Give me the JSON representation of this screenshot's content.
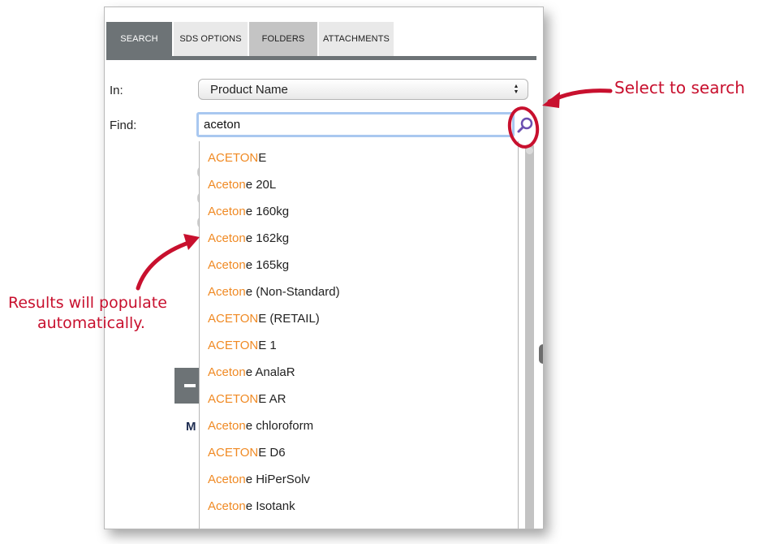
{
  "tabs": [
    {
      "label": "SEARCH",
      "state": "active"
    },
    {
      "label": "SDS OPTIONS",
      "state": "normal"
    },
    {
      "label": "FOLDERS",
      "state": "grey"
    },
    {
      "label": "ATTACHMENTS",
      "state": "normal"
    }
  ],
  "form": {
    "in_label": "In:",
    "in_value": "Product Name",
    "find_label": "Find:",
    "find_value": "aceton"
  },
  "results": [
    {
      "match": "ACETON",
      "rest": "E"
    },
    {
      "match": "Aceton",
      "rest": "e 20L"
    },
    {
      "match": "Aceton",
      "rest": "e 160kg"
    },
    {
      "match": "Aceton",
      "rest": "e 162kg"
    },
    {
      "match": "Aceton",
      "rest": "e 165kg"
    },
    {
      "match": "Aceton",
      "rest": "e (Non-Standard)"
    },
    {
      "match": "ACETON",
      "rest": "E (RETAIL)"
    },
    {
      "match": "ACETON",
      "rest": "E 1"
    },
    {
      "match": "Aceton",
      "rest": "e AnalaR"
    },
    {
      "match": "ACETON",
      "rest": "E AR"
    },
    {
      "match": "Aceton",
      "rest": "e chloroform"
    },
    {
      "match": "ACETON",
      "rest": "E D6"
    },
    {
      "match": "Aceton",
      "rest": "e HiPerSolv"
    },
    {
      "match": "Aceton",
      "rest": "e Isotank"
    }
  ],
  "background": {
    "m_letter": "M"
  },
  "annotations": {
    "select_to_search": "Select to search",
    "results_line1": "Results will populate",
    "results_line2": "automatically."
  },
  "colors": {
    "accent_tab": "#6d7376",
    "match_highlight": "#f08a24",
    "annotation": "#c8102e",
    "focus_ring": "#a9c8f0",
    "search_icon": "#6b4fb0"
  },
  "icons": {
    "search_button": "magnifier-icon",
    "select_arrows": "updown-arrows-icon"
  }
}
